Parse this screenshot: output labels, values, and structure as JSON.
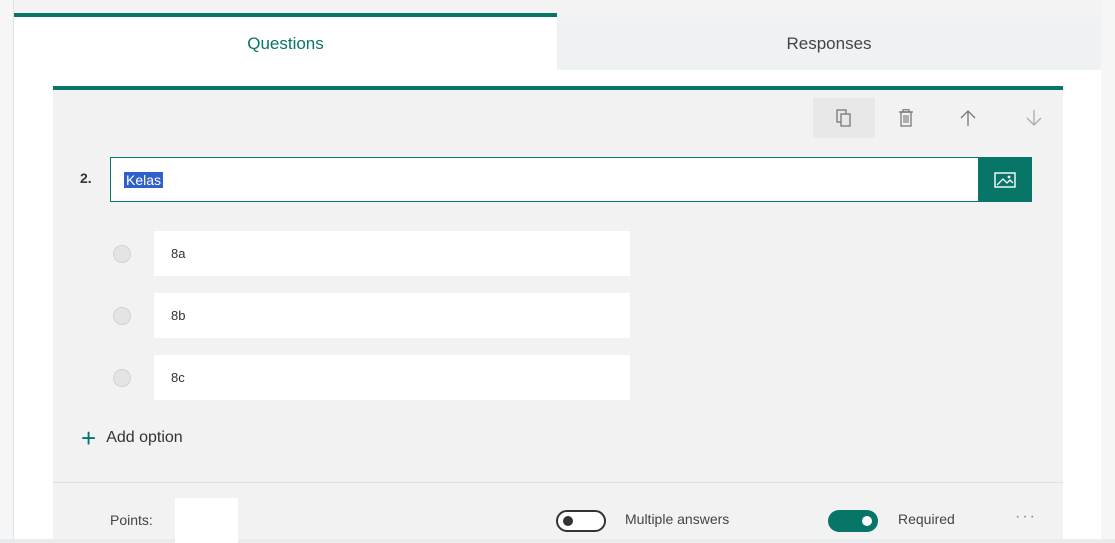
{
  "tabs": {
    "questions": "Questions",
    "responses": "Responses"
  },
  "toolbar": {
    "copy_icon": "copy-icon",
    "delete_icon": "trash-icon",
    "up_icon": "arrow-up-icon",
    "down_icon": "arrow-down-icon"
  },
  "question": {
    "number": "2.",
    "title": "Kelas",
    "image_icon": "image-icon"
  },
  "options": [
    {
      "label": "8a"
    },
    {
      "label": "8b"
    },
    {
      "label": "8c"
    }
  ],
  "add_option": "Add option",
  "footer": {
    "points_label": "Points:",
    "points_value": "",
    "multiple_answers_label": "Multiple answers",
    "multiple_answers_on": false,
    "required_label": "Required",
    "required_on": true,
    "more": "···"
  },
  "colors": {
    "accent": "#077568",
    "selection": "#3060c8"
  }
}
